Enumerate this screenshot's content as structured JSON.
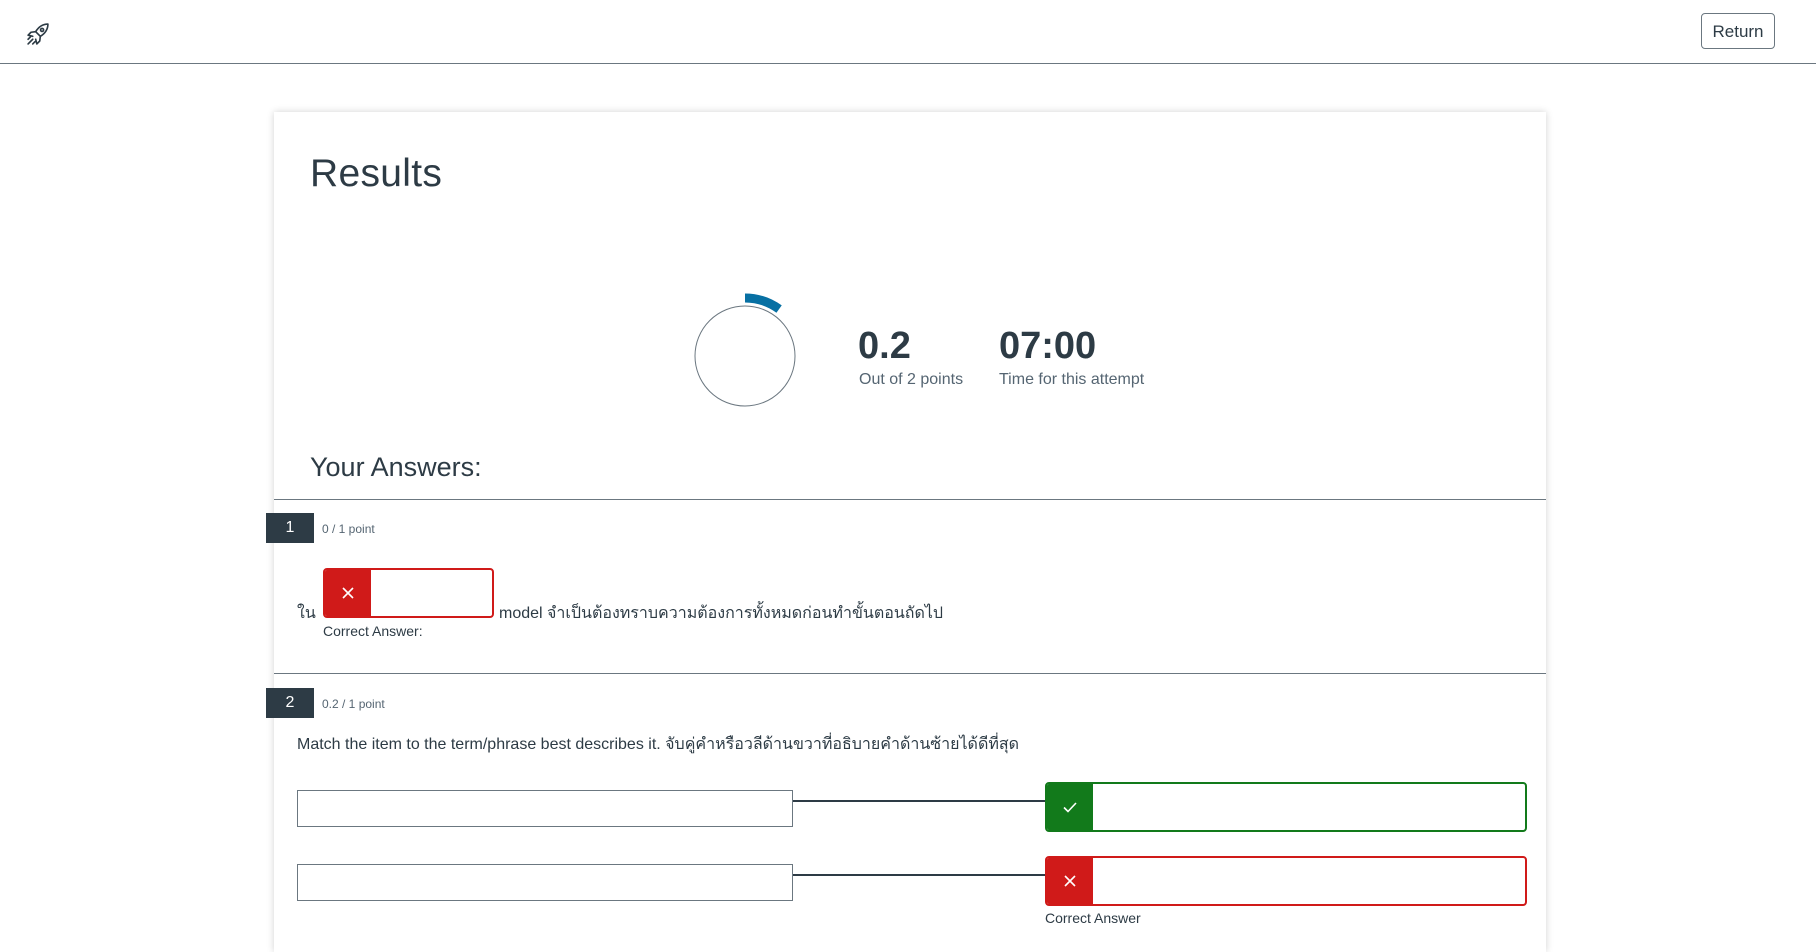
{
  "header": {
    "logo_icon": "rocket-icon",
    "return_label": "Return"
  },
  "results": {
    "title": "Results",
    "score_value": "0.2",
    "score_label": "Out of 2 points",
    "score_fraction": 0.1,
    "time_value": "07:00",
    "time_label": "Time for this attempt",
    "ring_color": "#0770a3"
  },
  "answers": {
    "title": "Your Answers:",
    "questions": [
      {
        "number": "1",
        "points": "0 / 1 point",
        "prefix_text": "ใน",
        "suffix_text": "model จำเป็นต้องทราบความต้องการทั้งหมดก่อนทำขั้นตอนถัดไป",
        "status_icon": "x-icon",
        "correct_answer_label": "Correct Answer:"
      },
      {
        "number": "2",
        "points": "0.2 / 1 point",
        "prompt": "Match the item to the term/phrase best describes it. จับคู่คำหรือวลีด้านขวาที่อธิบายคำด้านซ้ายได้ดีที่สุด",
        "pairs": [
          {
            "status": "correct",
            "status_icon": "check-icon"
          },
          {
            "status": "incorrect",
            "status_icon": "x-icon",
            "correct_answer_label": "Correct Answer"
          }
        ]
      }
    ]
  },
  "colors": {
    "correct": "#127a1b",
    "incorrect": "#d01a19",
    "dark": "#2d3b45"
  }
}
